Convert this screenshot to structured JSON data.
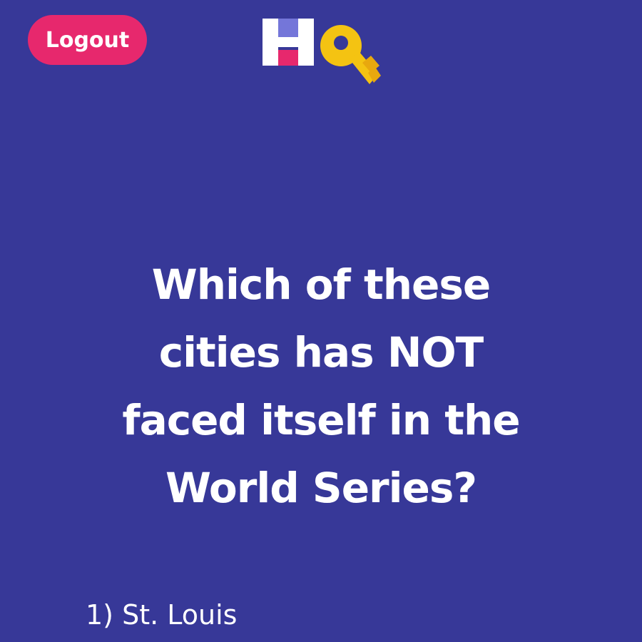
{
  "header": {
    "logout_label": "Logout",
    "logo_text": "HQ",
    "logo_icon": "hq-key-logo",
    "colors": {
      "background": "#373898",
      "logout_button": "#e7286d",
      "logo_h_top": "#7476d9",
      "logo_h_bottom": "#e7286d",
      "logo_key": "#f4c312"
    }
  },
  "question": {
    "line1": "Which of these",
    "line2": "cities has NOT",
    "line3": "faced itself in the",
    "line4": "World Series?"
  },
  "answers": [
    {
      "label": "1) St. Louis"
    }
  ]
}
